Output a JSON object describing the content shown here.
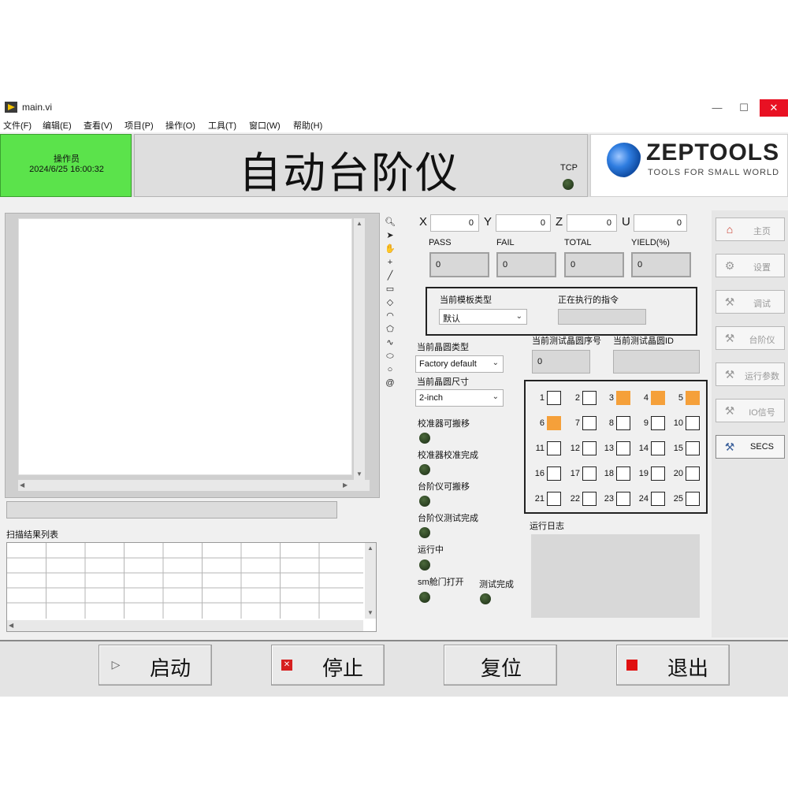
{
  "window": {
    "title": "main.vi",
    "minimize": "—",
    "maximize": "☐",
    "close": "✕"
  },
  "menu": [
    "文件(F)",
    "编辑(E)",
    "查看(V)",
    "项目(P)",
    "操作(O)",
    "工具(T)",
    "窗口(W)",
    "帮助(H)"
  ],
  "header": {
    "operator_label": "操作员",
    "datetime": "2024/6/25 16:00:32",
    "title": "自动台阶仪",
    "tcp_label": "TCP",
    "logo_text": "ZEPTOOLS",
    "logo_tagline": "TOOLS FOR SMALL WORLD"
  },
  "coords": {
    "x_label": "X",
    "x_value": "0",
    "y_label": "Y",
    "y_value": "0",
    "z_label": "Z",
    "z_value": "0",
    "u_label": "U",
    "u_value": "0"
  },
  "stats": {
    "pass_label": "PASS",
    "pass_value": "0",
    "fail_label": "FAIL",
    "fail_value": "0",
    "total_label": "TOTAL",
    "total_value": "0",
    "yield_label": "YIELD(%)",
    "yield_value": "0"
  },
  "recipe": {
    "model_label": "当前模板类型",
    "model_value": "默认",
    "command_label": "正在执行的指令",
    "command_value": ""
  },
  "wafer": {
    "type_label": "当前晶圆类型",
    "type_value": "Factory default",
    "size_label": "当前晶圆尺寸",
    "size_value": "2-inch",
    "seq_label": "当前测试晶圆序号",
    "seq_value": "0",
    "id_label": "当前测试晶圆ID",
    "id_value": ""
  },
  "status_lights": [
    {
      "label": "校准器可搬移"
    },
    {
      "label": "校准器校准完成"
    },
    {
      "label": "台阶仪可搬移"
    },
    {
      "label": "台阶仪测试完成"
    },
    {
      "label": "运行中"
    },
    {
      "label": "sm舱门打开"
    },
    {
      "label": "测试完成"
    }
  ],
  "slots": [
    {
      "n": "1",
      "on": false
    },
    {
      "n": "2",
      "on": false
    },
    {
      "n": "3",
      "on": true
    },
    {
      "n": "4",
      "on": true
    },
    {
      "n": "5",
      "on": true
    },
    {
      "n": "6",
      "on": true
    },
    {
      "n": "7",
      "on": false
    },
    {
      "n": "8",
      "on": false
    },
    {
      "n": "9",
      "on": false
    },
    {
      "n": "10",
      "on": false
    },
    {
      "n": "11",
      "on": false
    },
    {
      "n": "12",
      "on": false
    },
    {
      "n": "13",
      "on": false
    },
    {
      "n": "14",
      "on": false
    },
    {
      "n": "15",
      "on": false
    },
    {
      "n": "16",
      "on": false
    },
    {
      "n": "17",
      "on": false
    },
    {
      "n": "18",
      "on": false
    },
    {
      "n": "19",
      "on": false
    },
    {
      "n": "20",
      "on": false
    },
    {
      "n": "21",
      "on": false
    },
    {
      "n": "22",
      "on": false
    },
    {
      "n": "23",
      "on": false
    },
    {
      "n": "24",
      "on": false
    },
    {
      "n": "25",
      "on": false
    }
  ],
  "slot_on_color": "#f5a03a",
  "log_label": "运行日志",
  "scan_label": "扫描结果列表",
  "nav": [
    {
      "label": "主页",
      "icon": "home-icon",
      "glyph": "⌂",
      "active": true
    },
    {
      "label": "设置",
      "icon": "gear-icon",
      "glyph": "⚙",
      "active": false
    },
    {
      "label": "调试",
      "icon": "wrench-icon",
      "glyph": "⚒",
      "active": false
    },
    {
      "label": "台阶仪",
      "icon": "probe-icon",
      "glyph": "⚒",
      "active": false
    },
    {
      "label": "运行参数",
      "icon": "parameters-icon",
      "glyph": "⚒",
      "active": false
    },
    {
      "label": "IO信号",
      "icon": "io-signal-icon",
      "glyph": "⚒",
      "active": false
    },
    {
      "label": "SECS",
      "icon": "tools-icon",
      "glyph": "⚒",
      "active": true
    }
  ],
  "actions": {
    "start": "启动",
    "stop": "停止",
    "reset": "复位",
    "exit": "退出"
  },
  "colors": {
    "operator_bg": "#5be34b",
    "led_off": "#2b3f22",
    "exit_icon": "#e01010",
    "stop_icon": "#d62020"
  }
}
